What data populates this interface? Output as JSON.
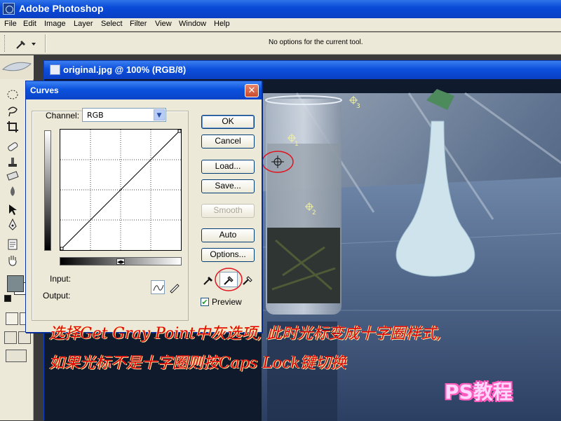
{
  "app": {
    "title": "Adobe Photoshop"
  },
  "menu": [
    "File",
    "Edit",
    "Image",
    "Layer",
    "Select",
    "Filter",
    "View",
    "Window",
    "Help"
  ],
  "options_bar": {
    "message": "No options for the current tool."
  },
  "document": {
    "title": "original.jpg @ 100% (RGB/8)"
  },
  "curves": {
    "title": "Curves",
    "close_glyph": "✕",
    "channel_label": "Channel:",
    "channel_value": "RGB",
    "input_label": "Input:",
    "output_label": "Output:",
    "buttons": {
      "ok": "OK",
      "cancel": "Cancel",
      "load": "Load...",
      "save": "Save...",
      "smooth": "Smooth",
      "auto": "Auto",
      "options": "Options..."
    },
    "preview_label": "Preview",
    "preview_checked": true
  },
  "markers": [
    "1",
    "2",
    "3"
  ],
  "caption": {
    "line1": "选择Get Gray Point中灰选项, 此时光标变成十字圈样式,",
    "line2": "如果光标不是十字圈则按Caps Lock键切换"
  },
  "watermark": "PS教程",
  "colors": {
    "xp_blue": "#0a3fc4",
    "dialog_bg": "#ece9d8",
    "caption_red": "#e00000",
    "highlight_red": "#e0141e"
  }
}
